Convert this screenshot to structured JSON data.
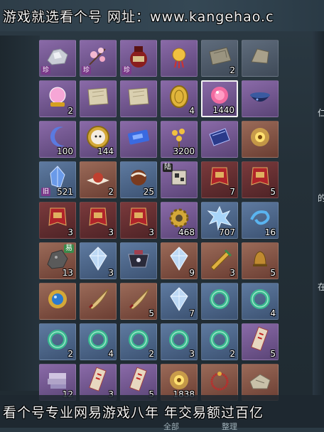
{
  "banners": {
    "top": "游戏就选看个号  网址：www.kangehao.c",
    "bottom": "看个号专业网易游戏八年  年交易额过百亿"
  },
  "bottom_tabs": [
    "全部",
    "整理"
  ],
  "side_chars": [
    "仁",
    "的",
    "在"
  ],
  "inventory": {
    "rows": [
      [
        {
          "icon": "silver-ore-icon",
          "tag": "珍",
          "qty": "",
          "rarity": "purple"
        },
        {
          "icon": "peach-blossom-icon",
          "tag": "珍",
          "qty": "",
          "rarity": "purple"
        },
        {
          "icon": "wine-jar-icon",
          "tag": "珍",
          "qty": "",
          "rarity": "purple"
        },
        {
          "icon": "pouch-charm-icon",
          "tag": "",
          "qty": "",
          "rarity": "purple"
        },
        {
          "icon": "stone-slab-icon",
          "tag": "",
          "qty": "2",
          "rarity": "green"
        },
        {
          "icon": "rock-fragment-icon",
          "tag": "",
          "qty": "",
          "rarity": "green"
        }
      ],
      [
        {
          "icon": "crystal-ball-icon",
          "tag": "",
          "qty": "2",
          "rarity": "purple"
        },
        {
          "icon": "scroll-map-icon",
          "tag": "",
          "qty": "",
          "rarity": "purple"
        },
        {
          "icon": "scroll-map-icon",
          "tag": "",
          "qty": "",
          "rarity": "purple"
        },
        {
          "icon": "gold-coin-icon",
          "tag": "",
          "qty": "4",
          "rarity": "purple"
        },
        {
          "icon": "pink-orb-icon",
          "tag": "",
          "qty": "1440",
          "rarity": "purple",
          "selected": true
        },
        {
          "icon": "blue-bowl-icon",
          "tag": "",
          "qty": "",
          "rarity": "purple"
        }
      ],
      [
        {
          "icon": "crescent-moon-icon",
          "tag": "",
          "qty": "100",
          "rarity": "purple"
        },
        {
          "icon": "character-medal-icon",
          "tag": "",
          "qty": "144",
          "rarity": "purple"
        },
        {
          "icon": "ticket-card-icon",
          "tag": "",
          "qty": "",
          "rarity": "purple"
        },
        {
          "icon": "golden-flower-icon",
          "tag": "",
          "qty": "3200",
          "rarity": "purple"
        },
        {
          "icon": "blue-book-icon",
          "tag": "",
          "qty": "",
          "rarity": "purple"
        },
        {
          "icon": "golden-eye-icon",
          "tag": "",
          "qty": "",
          "rarity": "gold"
        }
      ],
      [
        {
          "icon": "blue-crystal-icon",
          "tag": "旧",
          "qty": "521",
          "rarity": "blue"
        },
        {
          "icon": "red-pastry-icon",
          "tag": "",
          "qty": "2",
          "rarity": "gold"
        },
        {
          "icon": "chestnut-cake-icon",
          "tag": "",
          "qty": "25",
          "rarity": "blue"
        },
        {
          "icon": "puzzle-cube-icon",
          "tag": "陆",
          "qty": "",
          "rarity": "purple"
        },
        {
          "icon": "red-banner-icon",
          "tag": "",
          "qty": "7",
          "rarity": "red"
        },
        {
          "icon": "red-banner-icon",
          "tag": "",
          "qty": "5",
          "rarity": "red"
        }
      ],
      [
        {
          "icon": "red-banner-icon",
          "tag": "",
          "qty": "3",
          "rarity": "red"
        },
        {
          "icon": "red-banner-icon",
          "tag": "",
          "qty": "3",
          "rarity": "red"
        },
        {
          "icon": "red-banner-icon",
          "tag": "",
          "qty": "3",
          "rarity": "red"
        },
        {
          "icon": "gear-cog-icon",
          "tag": "",
          "qty": "468",
          "rarity": "purple"
        },
        {
          "icon": "ice-crystal-icon",
          "tag": "",
          "qty": "707",
          "rarity": "blue"
        },
        {
          "icon": "blue-swirl-icon",
          "tag": "",
          "qty": "16",
          "rarity": "blue"
        }
      ],
      [
        {
          "icon": "dark-ore-icon",
          "tag": "易",
          "qty": "13",
          "rarity": "gold"
        },
        {
          "icon": "diamond-gem-icon",
          "tag": "",
          "qty": "3",
          "rarity": "blue"
        },
        {
          "icon": "ornate-bag-icon",
          "tag": "",
          "qty": "",
          "rarity": "blue"
        },
        {
          "icon": "diamond-gem-icon",
          "tag": "",
          "qty": "9",
          "rarity": "gold"
        },
        {
          "icon": "golden-dagger-icon",
          "tag": "",
          "qty": "3",
          "rarity": "gold"
        },
        {
          "icon": "bronze-bell-icon",
          "tag": "",
          "qty": "5",
          "rarity": "gold"
        }
      ],
      [
        {
          "icon": "jeweled-amulet-icon",
          "tag": "",
          "qty": "",
          "rarity": "gold"
        },
        {
          "icon": "curved-blade-icon",
          "tag": "",
          "qty": "",
          "rarity": "gold"
        },
        {
          "icon": "curved-blade-icon",
          "tag": "",
          "qty": "5",
          "rarity": "gold"
        },
        {
          "icon": "diamond-gem-icon",
          "tag": "",
          "qty": "7",
          "rarity": "blue"
        },
        {
          "icon": "jade-ring-icon",
          "tag": "",
          "qty": "",
          "rarity": "blue"
        },
        {
          "icon": "jade-ring-icon",
          "tag": "",
          "qty": "4",
          "rarity": "blue"
        }
      ],
      [
        {
          "icon": "jade-ring-icon",
          "tag": "",
          "qty": "2",
          "rarity": "blue"
        },
        {
          "icon": "jade-ring-icon",
          "tag": "",
          "qty": "4",
          "rarity": "blue"
        },
        {
          "icon": "jade-ring-icon",
          "tag": "",
          "qty": "2",
          "rarity": "blue"
        },
        {
          "icon": "jade-ring-icon",
          "tag": "",
          "qty": "3",
          "rarity": "blue"
        },
        {
          "icon": "jade-ring-icon",
          "tag": "",
          "qty": "2",
          "rarity": "blue"
        },
        {
          "icon": "talisman-paper-icon",
          "tag": "",
          "qty": "5",
          "rarity": "purple"
        }
      ],
      [
        {
          "icon": "book-stack-icon",
          "tag": "",
          "qty": "12",
          "rarity": "purple"
        },
        {
          "icon": "talisman-paper-icon",
          "tag": "",
          "qty": "3",
          "rarity": "purple"
        },
        {
          "icon": "talisman-paper-icon",
          "tag": "",
          "qty": "5",
          "rarity": "purple"
        },
        {
          "icon": "golden-eye-icon",
          "tag": "",
          "qty": "1838",
          "rarity": "gold"
        },
        {
          "icon": "red-bracelet-icon",
          "tag": "",
          "qty": "",
          "rarity": "gold"
        },
        {
          "icon": "cloth-bundle-icon",
          "tag": "",
          "qty": "",
          "rarity": "gold"
        }
      ]
    ]
  },
  "colors": {
    "purple": "#6e5690",
    "gold": "#8a5748",
    "blue": "#4e6890",
    "red": "#63303a",
    "green": "#4f5b6a"
  }
}
